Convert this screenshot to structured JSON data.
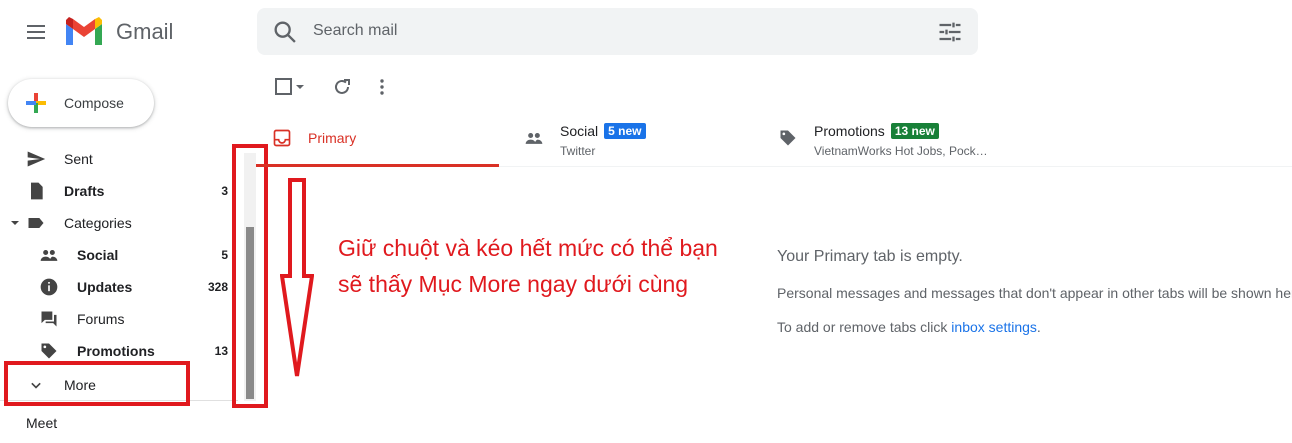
{
  "app": {
    "name": "Gmail"
  },
  "search": {
    "placeholder": "Search mail"
  },
  "compose": {
    "label": "Compose"
  },
  "nav": {
    "items": [
      {
        "label": "Sent",
        "count": "",
        "bold": false,
        "icon": "send-icon"
      },
      {
        "label": "Drafts",
        "count": "3",
        "bold": true,
        "icon": "draft-icon"
      },
      {
        "label": "Categories",
        "count": "",
        "bold": false,
        "icon": "label-icon"
      },
      {
        "label": "Social",
        "count": "5",
        "bold": true,
        "icon": "people-icon"
      },
      {
        "label": "Updates",
        "count": "328",
        "bold": true,
        "icon": "info-icon"
      },
      {
        "label": "Forums",
        "count": "",
        "bold": false,
        "icon": "forum-icon"
      },
      {
        "label": "Promotions",
        "count": "13",
        "bold": true,
        "icon": "tag-icon"
      },
      {
        "label": "More",
        "count": "",
        "bold": false,
        "icon": "chevron-down-icon"
      }
    ],
    "meet": "Meet"
  },
  "tabs": {
    "primary": {
      "label": "Primary"
    },
    "social": {
      "label": "Social",
      "badge": "5 new",
      "sub": "Twitter",
      "badge_color": "#1a73e8"
    },
    "promotions": {
      "label": "Promotions",
      "badge": "13 new",
      "sub": "VietnamWorks Hot Jobs, Pock…",
      "badge_color": "#188038"
    }
  },
  "empty": {
    "title": "Your Primary tab is empty.",
    "line1": "Personal messages and messages that don't appear in other tabs will be shown here",
    "line2_prefix": "To add or remove tabs click ",
    "line2_link": "inbox settings",
    "line2_suffix": "."
  },
  "annotation": {
    "text": "Giữ chuột và kéo hết mức có thể bạn sẽ thấy Mục More ngay dưới cùng",
    "color": "#e0191e"
  },
  "colors": {
    "accent_red": "#d93025",
    "link": "#1a73e8"
  }
}
